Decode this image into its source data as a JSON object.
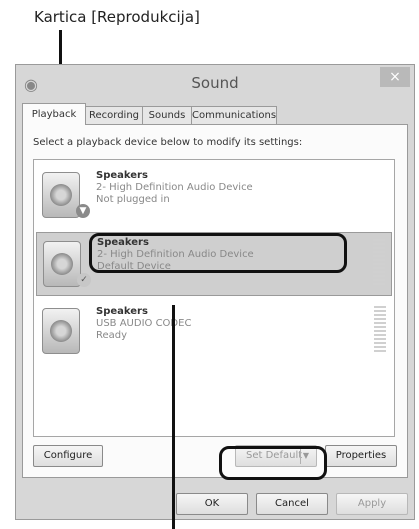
{
  "callout": {
    "label": "Kartica [Reprodukcija]"
  },
  "window": {
    "title": "Sound",
    "close_glyph": "×"
  },
  "tabs": [
    {
      "label": "Playback",
      "active": true
    },
    {
      "label": "Recording"
    },
    {
      "label": "Sounds"
    },
    {
      "label": "Communications"
    }
  ],
  "playback": {
    "instruction": "Select a playback device below to modify its settings:",
    "devices": [
      {
        "name": "Speakers",
        "line2": "2- High Definition Audio Device",
        "status": "Not plugged in",
        "icon": "speaker-icon",
        "badge": "arrow-down-icon"
      },
      {
        "name": "Speakers",
        "line2": "2- High Definition Audio Device",
        "status": "Default Device",
        "icon": "speaker-icon",
        "badge": "checkmark-icon",
        "selected": true
      },
      {
        "name": "Speakers",
        "line2": "USB AUDIO  CODEC",
        "status": "Ready",
        "icon": "speaker-icon"
      }
    ],
    "buttons": {
      "configure": "Configure",
      "set_default": "Set Default",
      "properties": "Properties"
    }
  },
  "dialog_buttons": {
    "ok": "OK",
    "cancel": "Cancel",
    "apply": "Apply"
  },
  "colors": {
    "window_bg": "#d7d7d7",
    "selected_row": "#cfcfcf",
    "annotation": "#111111"
  }
}
